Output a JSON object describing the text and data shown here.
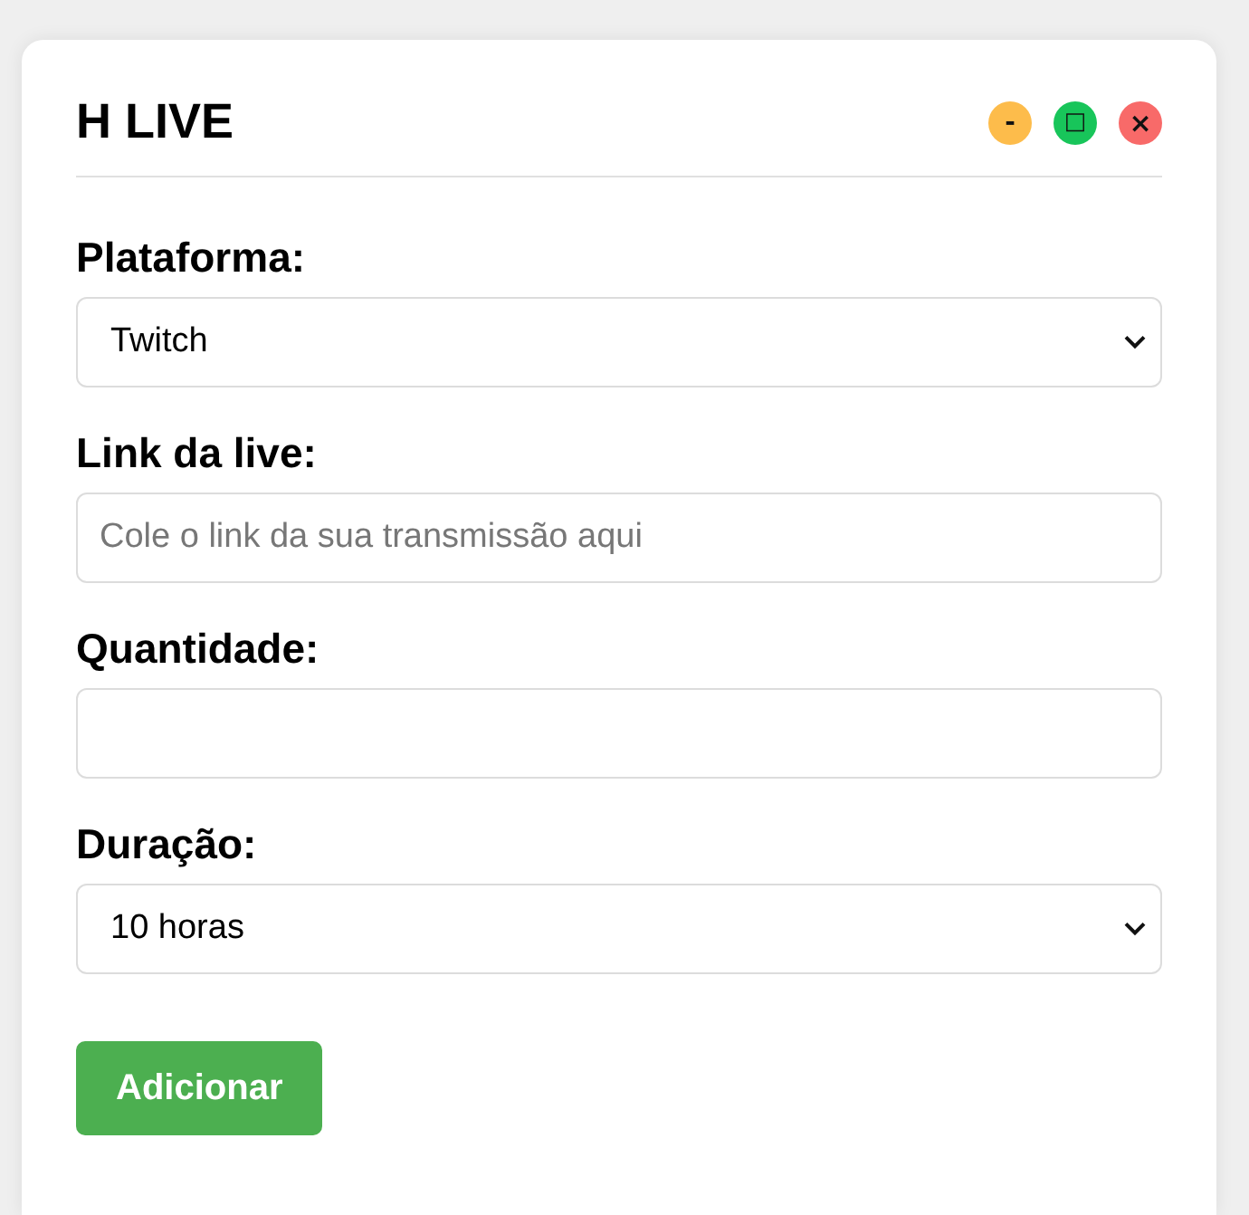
{
  "window": {
    "title": "H LIVE",
    "controls": [
      {
        "kind": "minimize",
        "label": "-",
        "color": "#fdbc4b"
      },
      {
        "kind": "maximize",
        "label": "□",
        "color": "#18c55a"
      },
      {
        "kind": "close",
        "label": "×",
        "color": "#f86a69"
      }
    ]
  },
  "form": {
    "fields": [
      {
        "kind": "select",
        "label": "Plataforma:",
        "value": "Twitch"
      },
      {
        "kind": "input",
        "label": "Link da live:",
        "placeholder": "Cole o link da sua transmissão aqui"
      },
      {
        "kind": "input",
        "label": "Quantidade:"
      },
      {
        "kind": "select",
        "label": "Duração:",
        "value": "10 horas"
      }
    ],
    "submit": "Adicionar"
  }
}
